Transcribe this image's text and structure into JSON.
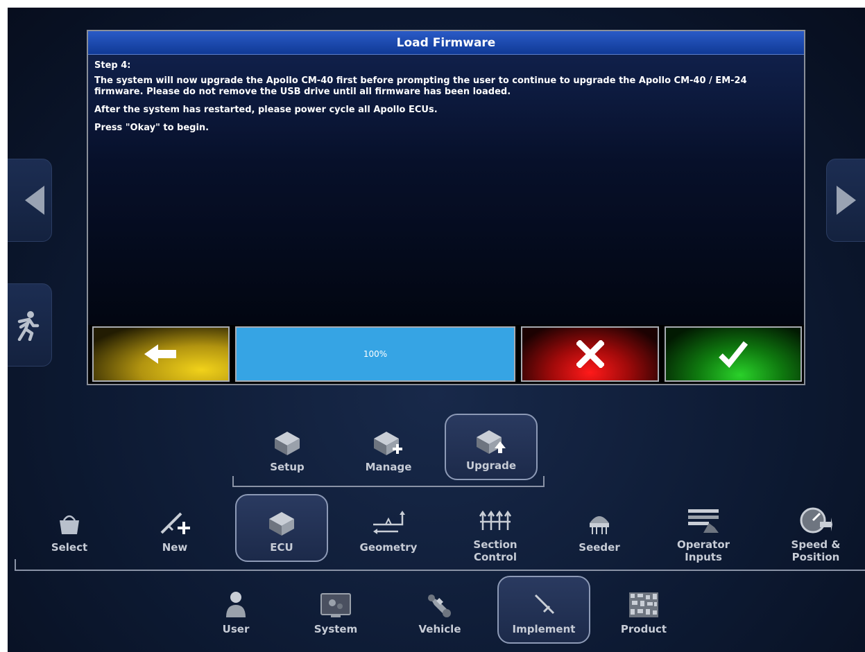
{
  "dialog": {
    "title": "Load Firmware",
    "step": "Step 4:",
    "paragraph1": "The system will now upgrade the Apollo CM-40 first before prompting the user to continue to upgrade the Apollo CM-40 / EM-24 firmware. Please do not remove the USB drive until all firmware has been loaded.",
    "paragraph2": "After the system has restarted, please power cycle all Apollo ECUs.",
    "paragraph3": "Press \"Okay\" to begin.",
    "progress_label": "100%",
    "progress_value": 1.0,
    "buttons": {
      "back_icon": "arrow-left-icon",
      "cancel_icon": "x-icon",
      "ok_icon": "checkmark-icon"
    }
  },
  "side_nav": {
    "left_arrow_icon": "chevron-left-icon",
    "right_arrow_icon": "chevron-right-icon",
    "exit_icon": "running-man-icon"
  },
  "ecu_submenu": {
    "items": [
      {
        "label": "Setup",
        "icon": "ecu-icon"
      },
      {
        "label": "Manage",
        "icon": "ecu-add-icon"
      },
      {
        "label": "Upgrade",
        "icon": "ecu-upgrade-icon",
        "selected": true
      }
    ]
  },
  "implement_menu": {
    "items": [
      {
        "label": "Select",
        "icon": "basket-icon"
      },
      {
        "label": "New",
        "icon": "implement-add-icon"
      },
      {
        "label": "ECU",
        "icon": "ecu-icon",
        "selected": true
      },
      {
        "label": "Geometry",
        "icon": "geometry-icon"
      },
      {
        "label": "Section\nControl",
        "icon": "section-control-icon"
      },
      {
        "label": "Seeder",
        "icon": "seeder-icon"
      },
      {
        "label": "Operator\nInputs",
        "icon": "operator-inputs-icon"
      },
      {
        "label": "Speed &\nPosition",
        "icon": "speedometer-icon"
      }
    ]
  },
  "main_menu": {
    "items": [
      {
        "label": "User",
        "icon": "user-icon"
      },
      {
        "label": "System",
        "icon": "system-icon"
      },
      {
        "label": "Vehicle",
        "icon": "vehicle-icon"
      },
      {
        "label": "Implement",
        "icon": "implement-icon",
        "selected": true
      },
      {
        "label": "Product",
        "icon": "product-icon"
      }
    ]
  }
}
